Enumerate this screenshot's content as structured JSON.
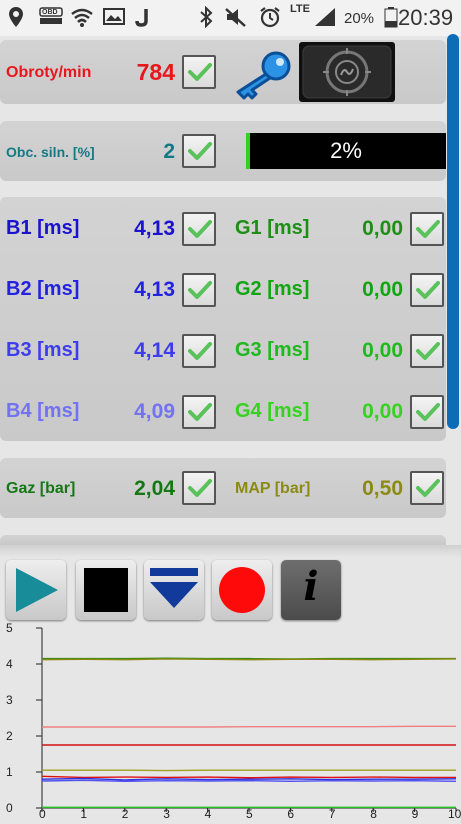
{
  "status": {
    "lte_label": "LTE",
    "battery": "20%",
    "time": "20:39",
    "obd_label": "OBD"
  },
  "rpm": {
    "label": "Obroty/min",
    "value": "784"
  },
  "load": {
    "label": "Obc. siln. [%]",
    "value": "2",
    "bar_text": "2%",
    "bar_fraction": 0.02
  },
  "injectors": [
    {
      "b_label": "B1 [ms]",
      "b_value": "4,13",
      "g_label": "G1 [ms]",
      "g_value": "0,00"
    },
    {
      "b_label": "B2 [ms]",
      "b_value": "4,13",
      "g_label": "G2 [ms]",
      "g_value": "0,00"
    },
    {
      "b_label": "B3 [ms]",
      "b_value": "4,14",
      "g_label": "G3 [ms]",
      "g_value": "0,00"
    },
    {
      "b_label": "B4 [ms]",
      "b_value": "4,09",
      "g_label": "G4 [ms]",
      "g_value": "0,00"
    }
  ],
  "pressure": {
    "gaz_label": "Gaz [bar]",
    "gaz_value": "2,04",
    "map_label": "MAP [bar]",
    "map_value": "0,50"
  },
  "toolbar": [
    "play-icon",
    "stop-icon",
    "download-icon",
    "record-icon",
    "info-icon"
  ],
  "info_glyph": "i",
  "colors": {
    "rpm": "#e8171d",
    "load": "#127a86",
    "b1": "#1b12d0",
    "b2": "#2222e0",
    "b3": "#3d3dee",
    "b4": "#7272f2",
    "g1": "#1e8f16",
    "g2": "#12a512",
    "g3": "#1fb81f",
    "g4": "#35d21f",
    "gaz": "#177717",
    "map": "#8b8b14",
    "bar_fill": "#30d21e",
    "scroll": "#0d6cb6"
  },
  "chart_data": {
    "type": "line",
    "xlim": [
      0,
      10
    ],
    "ylim": [
      0,
      5
    ],
    "x_ticks": [
      "0",
      "1",
      "2",
      "3",
      "4",
      "5",
      "6",
      "7",
      "8",
      "9",
      "10"
    ],
    "y_ticks": [
      "0",
      "1",
      "2",
      "3",
      "4",
      "5"
    ],
    "grid": false,
    "series": [
      {
        "color": "#3a8a1a",
        "values": [
          4.15,
          4.15,
          4.15,
          4.16,
          4.15,
          4.15,
          4.14,
          4.15,
          4.15,
          4.15,
          4.15
        ]
      },
      {
        "color": "#8a8a10",
        "values": [
          4.12,
          4.13,
          4.12,
          4.14,
          4.13,
          4.12,
          4.13,
          4.13,
          4.12,
          4.13,
          4.14
        ]
      },
      {
        "color": "#f08080",
        "values": [
          2.25,
          2.25,
          2.25,
          2.25,
          2.25,
          2.26,
          2.26,
          2.26,
          2.26,
          2.27,
          2.27
        ]
      },
      {
        "color": "#d01010",
        "values": [
          1.75,
          1.75,
          1.75,
          1.75,
          1.75,
          1.75,
          1.75,
          1.75,
          1.75,
          1.75,
          1.75
        ]
      },
      {
        "color": "#a0a020",
        "values": [
          1.05,
          1.05,
          1.05,
          1.04,
          1.05,
          1.05,
          1.05,
          1.05,
          1.05,
          1.05,
          1.05
        ]
      },
      {
        "color": "#e01010",
        "values": [
          0.88,
          0.85,
          0.86,
          0.85,
          0.86,
          0.84,
          0.86,
          0.85,
          0.86,
          0.85,
          0.85
        ]
      },
      {
        "color": "#3030e0",
        "values": [
          0.8,
          0.82,
          0.78,
          0.81,
          0.79,
          0.8,
          0.81,
          0.79,
          0.8,
          0.8,
          0.81
        ]
      },
      {
        "color": "#5050f0",
        "values": [
          0.75,
          0.77,
          0.74,
          0.76,
          0.75,
          0.76,
          0.74,
          0.76,
          0.75,
          0.76,
          0.74
        ]
      },
      {
        "color": "#20c020",
        "values": [
          0.02,
          0.02,
          0.02,
          0.02,
          0.02,
          0.02,
          0.02,
          0.02,
          0.02,
          0.02,
          0.02
        ]
      }
    ]
  }
}
